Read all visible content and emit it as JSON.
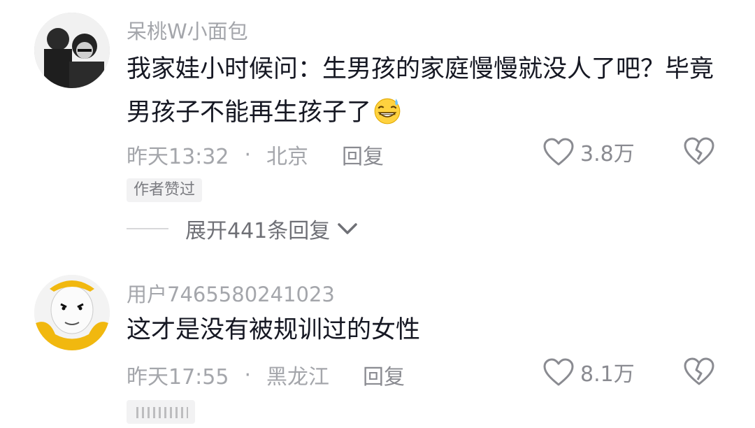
{
  "comments": [
    {
      "username": "呆桃W小面包",
      "content": "我家娃小时候问：生男孩的家庭慢慢就没人了吧？毕竟男孩子不能再生孩子了",
      "time": "昨天13:32",
      "separator": "·",
      "location": "北京",
      "reply_label": "回复",
      "likes": "3.8万",
      "tag": "作者赞过",
      "expand_label": "展开441条回复",
      "emoji_icon": "grinning-sweat-emoji"
    },
    {
      "username": "用户7465580241023",
      "content": "这才是没有被规训过的女性",
      "time": "昨天17:55",
      "separator": "·",
      "location": "黑龙江",
      "reply_label": "回复",
      "likes": "8.1万",
      "tag": ""
    }
  ],
  "colors": {
    "secondary_text": "#a4a6ab",
    "primary_text": "#161823",
    "tag_bg": "#f2f2f3"
  }
}
